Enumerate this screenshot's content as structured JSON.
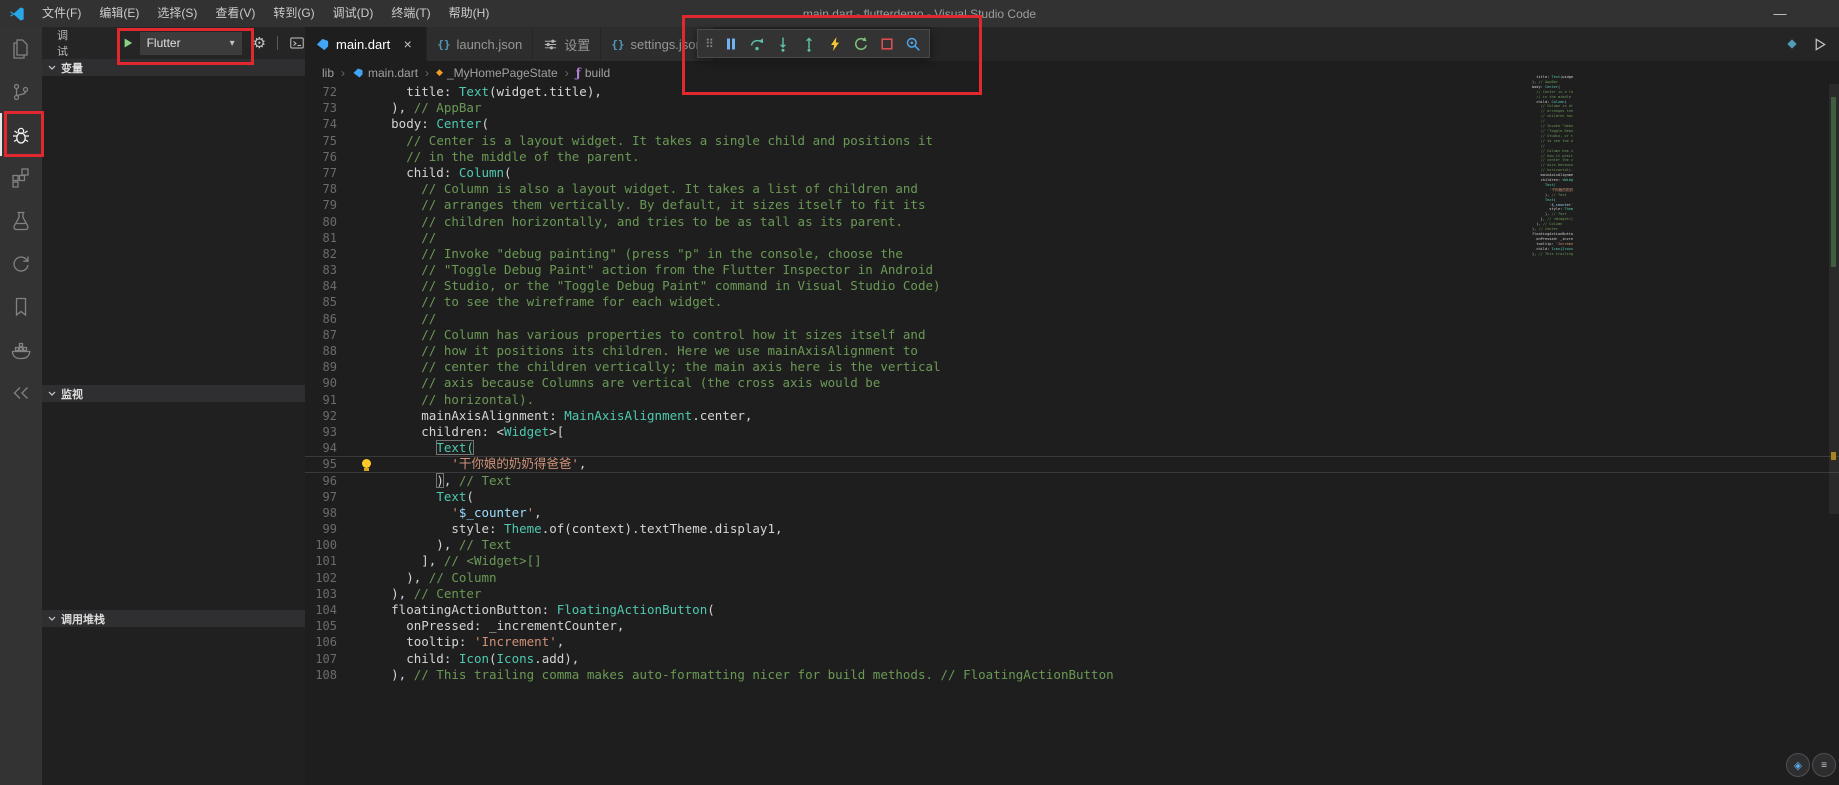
{
  "window": {
    "title": "main.dart - flutterdemo - Visual Studio Code",
    "minimize_glyph": "—",
    "menu_items": [
      "文件(F)",
      "编辑(E)",
      "选择(S)",
      "查看(V)",
      "转到(G)",
      "调试(D)",
      "终端(T)",
      "帮助(H)"
    ]
  },
  "activity_bar": {
    "icons": [
      "explorer-icon",
      "source-control-icon",
      "debug-icon",
      "extensions-icon",
      "test-flask-icon",
      "sync-icon",
      "bookmark-icon",
      "docker-icon",
      "remote-chevrons-icon"
    ],
    "active": "debug"
  },
  "sidebar": {
    "title": "调试",
    "launch_config": "Flutter",
    "dropdown_caret": "▾",
    "sections": [
      "变量",
      "监视",
      "调用堆栈"
    ]
  },
  "debug_toolbar": {
    "icons": [
      "drag-grip",
      "pause",
      "step-over",
      "step-into",
      "step-out",
      "hot-reload",
      "restart",
      "stop",
      "widget-inspector"
    ],
    "grip_glyph": "⠿"
  },
  "tabs": [
    {
      "label": "main.dart",
      "icon": "dart",
      "active": true,
      "close": "×"
    },
    {
      "label": "launch.json",
      "icon": "json",
      "json_glyph": "{}"
    },
    {
      "label": "设置",
      "icon": "settings"
    },
    {
      "label": "settings.json",
      "icon": "json",
      "json_glyph": "{}"
    }
  ],
  "editor_actions": [
    "gem-icon",
    "run-icon"
  ],
  "breadcrumbs": [
    {
      "label": "lib"
    },
    {
      "label": "main.dart",
      "icon": "dart-icon"
    },
    {
      "label": "_MyHomePageState",
      "icon": "class-icon",
      "glyph": "◆"
    },
    {
      "label": "build",
      "icon": "method-icon",
      "glyph": "ƒ"
    }
  ],
  "annotations": {
    "color": "#e0282e",
    "boxes": [
      "launch-config-dropdown",
      "debug-activity-icon",
      "debug-toolbar"
    ]
  },
  "floating_buttons": [
    {
      "glyph": "◈"
    },
    {
      "glyph": "≡"
    }
  ],
  "editor": {
    "language": "dart",
    "current_line": 95,
    "lightbulb_line": 95,
    "lines": [
      {
        "n": 72,
        "s": [
          [
            "w",
            "        title: "
          ],
          [
            "t",
            "Text"
          ],
          [
            "w",
            "(widget.title),"
          ]
        ]
      },
      {
        "n": 73,
        "s": [
          [
            "w",
            "      ), "
          ],
          [
            "c",
            "// AppBar"
          ]
        ]
      },
      {
        "n": 74,
        "s": [
          [
            "w",
            "      body: "
          ],
          [
            "t",
            "Center"
          ],
          [
            "w",
            "("
          ]
        ]
      },
      {
        "n": 75,
        "s": [
          [
            "w",
            "        "
          ],
          [
            "c",
            "// Center is a layout widget. It takes a single child and positions it"
          ]
        ]
      },
      {
        "n": 76,
        "s": [
          [
            "w",
            "        "
          ],
          [
            "c",
            "// in the middle of the parent."
          ]
        ]
      },
      {
        "n": 77,
        "s": [
          [
            "w",
            "        child: "
          ],
          [
            "t",
            "Column"
          ],
          [
            "w",
            "("
          ]
        ]
      },
      {
        "n": 78,
        "s": [
          [
            "w",
            "          "
          ],
          [
            "c",
            "// Column is also a layout widget. It takes a list of children and"
          ]
        ]
      },
      {
        "n": 79,
        "s": [
          [
            "w",
            "          "
          ],
          [
            "c",
            "// arranges them vertically. By default, it sizes itself to fit its"
          ]
        ]
      },
      {
        "n": 80,
        "s": [
          [
            "w",
            "          "
          ],
          [
            "c",
            "// children horizontally, and tries to be as tall as its parent."
          ]
        ]
      },
      {
        "n": 81,
        "s": [
          [
            "w",
            "          "
          ],
          [
            "c",
            "//"
          ]
        ]
      },
      {
        "n": 82,
        "s": [
          [
            "w",
            "          "
          ],
          [
            "c",
            "// Invoke \"debug painting\" (press \"p\" in the console, choose the"
          ]
        ]
      },
      {
        "n": 83,
        "s": [
          [
            "w",
            "          "
          ],
          [
            "c",
            "// \"Toggle Debug Paint\" action from the Flutter Inspector in Android"
          ]
        ]
      },
      {
        "n": 84,
        "s": [
          [
            "w",
            "          "
          ],
          [
            "c",
            "// Studio, or the \"Toggle Debug Paint\" command in Visual Studio Code)"
          ]
        ]
      },
      {
        "n": 85,
        "s": [
          [
            "w",
            "          "
          ],
          [
            "c",
            "// to see the wireframe for each widget."
          ]
        ]
      },
      {
        "n": 86,
        "s": [
          [
            "w",
            "          "
          ],
          [
            "c",
            "//"
          ]
        ]
      },
      {
        "n": 87,
        "s": [
          [
            "w",
            "          "
          ],
          [
            "c",
            "// Column has various properties to control how it sizes itself and"
          ]
        ]
      },
      {
        "n": 88,
        "s": [
          [
            "w",
            "          "
          ],
          [
            "c",
            "// how it positions its children. Here we use mainAxisAlignment to"
          ]
        ]
      },
      {
        "n": 89,
        "s": [
          [
            "w",
            "          "
          ],
          [
            "c",
            "// center the children vertically; the main axis here is the vertical"
          ]
        ]
      },
      {
        "n": 90,
        "s": [
          [
            "w",
            "          "
          ],
          [
            "c",
            "// axis because Columns are vertical (the cross axis would be"
          ]
        ]
      },
      {
        "n": 91,
        "s": [
          [
            "w",
            "          "
          ],
          [
            "c",
            "// horizontal)."
          ]
        ]
      },
      {
        "n": 92,
        "s": [
          [
            "w",
            "          mainAxisAlignment: "
          ],
          [
            "t",
            "MainAxisAlignment"
          ],
          [
            "w",
            ".center,"
          ]
        ]
      },
      {
        "n": 93,
        "s": [
          [
            "w",
            "          children: <"
          ],
          [
            "t",
            "Widget"
          ],
          [
            "w",
            ">["
          ]
        ]
      },
      {
        "n": 94,
        "s": [
          [
            "w",
            "            "
          ],
          [
            "tB",
            "Text("
          ]
        ]
      },
      {
        "n": 95,
        "s": [
          [
            "w",
            "              "
          ],
          [
            "s",
            "'干你娘的奶奶得爸爸'"
          ],
          [
            "w",
            ","
          ]
        ]
      },
      {
        "n": 96,
        "s": [
          [
            "w",
            "            "
          ],
          [
            "wB",
            ")"
          ],
          [
            "w",
            ", "
          ],
          [
            "c",
            "// Text"
          ]
        ]
      },
      {
        "n": 97,
        "s": [
          [
            "w",
            "            "
          ],
          [
            "t",
            "Text"
          ],
          [
            "w",
            "("
          ]
        ]
      },
      {
        "n": 98,
        "s": [
          [
            "w",
            "              "
          ],
          [
            "s",
            "'"
          ],
          [
            "v",
            "$_counter"
          ],
          [
            "s",
            "'"
          ],
          [
            "w",
            ","
          ]
        ]
      },
      {
        "n": 99,
        "s": [
          [
            "w",
            "              style: "
          ],
          [
            "t",
            "Theme"
          ],
          [
            "w",
            ".of(context).textTheme.display1,"
          ]
        ]
      },
      {
        "n": 100,
        "s": [
          [
            "w",
            "            ), "
          ],
          [
            "c",
            "// Text"
          ]
        ]
      },
      {
        "n": 101,
        "s": [
          [
            "w",
            "          ], "
          ],
          [
            "c",
            "// <Widget>[]"
          ]
        ]
      },
      {
        "n": 102,
        "s": [
          [
            "w",
            "        ), "
          ],
          [
            "c",
            "// Column"
          ]
        ]
      },
      {
        "n": 103,
        "s": [
          [
            "w",
            "      ), "
          ],
          [
            "c",
            "// Center"
          ]
        ]
      },
      {
        "n": 104,
        "s": [
          [
            "w",
            "      floatingActionButton: "
          ],
          [
            "t",
            "FloatingActionButton"
          ],
          [
            "w",
            "("
          ]
        ]
      },
      {
        "n": 105,
        "s": [
          [
            "w",
            "        onPressed: _incrementCounter,"
          ]
        ]
      },
      {
        "n": 106,
        "s": [
          [
            "w",
            "        tooltip: "
          ],
          [
            "s",
            "'Increment'"
          ],
          [
            "w",
            ","
          ]
        ]
      },
      {
        "n": 107,
        "s": [
          [
            "w",
            "        child: "
          ],
          [
            "t",
            "Icon"
          ],
          [
            "w",
            "("
          ],
          [
            "t",
            "Icons"
          ],
          [
            "w",
            ".add),"
          ]
        ]
      },
      {
        "n": 108,
        "s": [
          [
            "w",
            "      ), "
          ],
          [
            "c",
            "// This trailing comma makes auto-formatting nicer for build methods. // FloatingActionButton"
          ]
        ]
      }
    ]
  }
}
